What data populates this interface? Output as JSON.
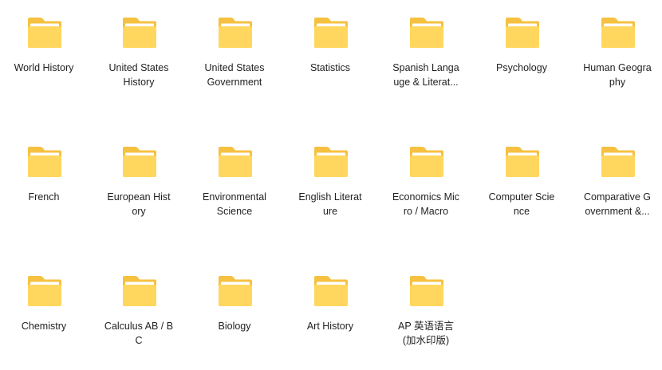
{
  "folders": [
    {
      "line1": "World History",
      "line2": ""
    },
    {
      "line1": "United States",
      "line2": "History"
    },
    {
      "line1": "United States",
      "line2": "Government"
    },
    {
      "line1": "Statistics",
      "line2": ""
    },
    {
      "line1": "Spanish Langa",
      "line2": "uge & Literat..."
    },
    {
      "line1": "Psychology",
      "line2": ""
    },
    {
      "line1": "Human Geogra",
      "line2": "phy"
    },
    {
      "line1": "French",
      "line2": ""
    },
    {
      "line1": "European Hist",
      "line2": "ory"
    },
    {
      "line1": "Environmental",
      "line2": "Science"
    },
    {
      "line1": "English Literat",
      "line2": "ure"
    },
    {
      "line1": "Economics Mic",
      "line2": "ro / Macro"
    },
    {
      "line1": "Computer Scie",
      "line2": "nce"
    },
    {
      "line1": "Comparative G",
      "line2": "overnment &..."
    },
    {
      "line1": "Chemistry",
      "line2": ""
    },
    {
      "line1": "Calculus AB / B",
      "line2": "C"
    },
    {
      "line1": "Biology",
      "line2": ""
    },
    {
      "line1": "Art History",
      "line2": ""
    },
    {
      "line1": "AP 英语语言",
      "line2": "(加水印版)"
    }
  ],
  "icon": {
    "name": "folder-icon",
    "back_color": "#F6C141",
    "front_color": "#FFD75E",
    "sheet_color": "#FFFFFF"
  }
}
